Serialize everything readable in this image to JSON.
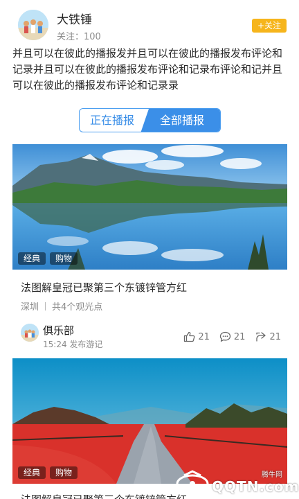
{
  "profile": {
    "username": "大铁锤",
    "follow_count": "关注：100",
    "follow_button": "+关注"
  },
  "description": "并且可以在彼此的播报发并且可以在彼此的播报发布评论和记录并且可以在彼此的播报发布评论和记录布评论和记并且可以在彼此的播报发布评论和记录录",
  "tabs": {
    "live": "正在播报",
    "all": "全部播报",
    "active": "all"
  },
  "posts": [
    {
      "tags": [
        "经典",
        "购物"
      ],
      "title": "法图解皇冠已聚第三个东镀锌管方红",
      "location": "深圳",
      "spots": "共4个观光点"
    },
    {
      "tags": [
        "经典",
        "购物"
      ],
      "title": "法图解皇冠已聚第三个东镀锌管方红"
    }
  ],
  "author": {
    "name": "俱乐部",
    "time": "15:24 发布游记",
    "likes": "21",
    "comments": "21",
    "shares": "21"
  },
  "watermark": {
    "text": "QQTN.com",
    "site": "腾牛网"
  },
  "colors": {
    "accent": "#3b8fe8",
    "follow": "#f6b51c"
  },
  "icons": [
    "thumbs-up-icon",
    "comment-icon",
    "share-icon"
  ]
}
